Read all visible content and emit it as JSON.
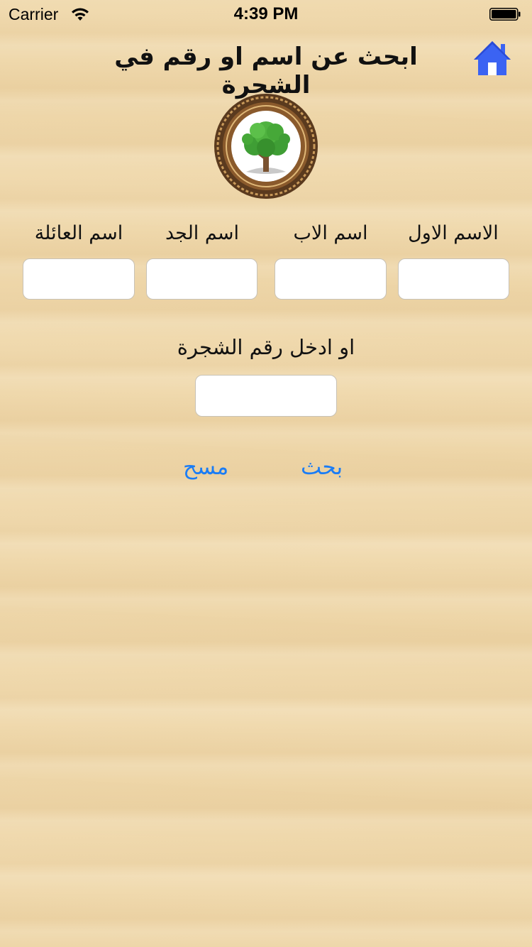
{
  "status_bar": {
    "carrier": "Carrier",
    "time": "4:39 PM",
    "wifi_icon": "wifi-icon",
    "battery_icon": "battery-icon"
  },
  "header": {
    "title": "ابحث عن اسم او رقم في الشجرة",
    "home_icon": "home-icon",
    "home_color": "#3b63f3"
  },
  "logo": {
    "icon": "tree-logo-icon"
  },
  "name_fields": [
    {
      "label": "الاسم الاول",
      "value": "",
      "placeholder": ""
    },
    {
      "label": "اسم الاب",
      "value": "",
      "placeholder": ""
    },
    {
      "label": "اسم الجد",
      "value": "",
      "placeholder": ""
    },
    {
      "label": "اسم العائلة",
      "value": "",
      "placeholder": ""
    }
  ],
  "tree_number": {
    "label": "او ادخل رقم الشجرة",
    "value": "",
    "placeholder": ""
  },
  "actions": {
    "search_label": "بحث",
    "clear_label": "مسح",
    "accent_color": "#1a7cf5"
  },
  "theme": {
    "background": "#f0d9ac"
  }
}
